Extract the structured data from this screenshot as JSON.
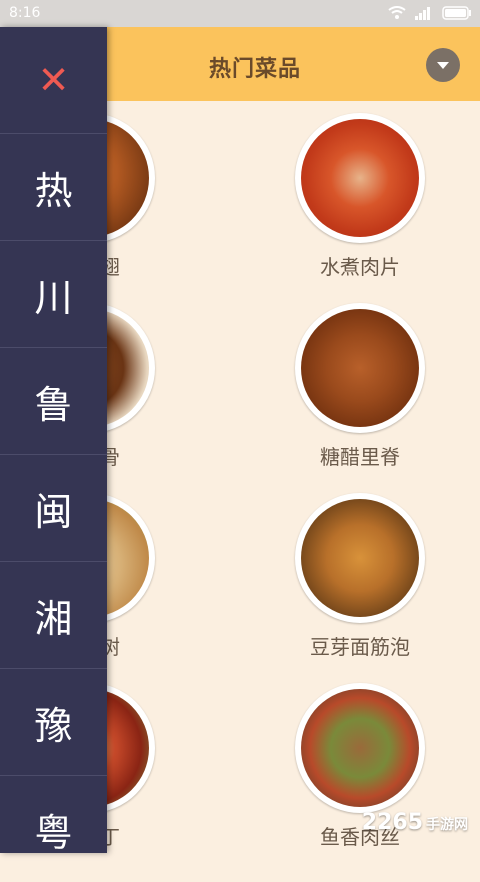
{
  "status_bar": {
    "time": "8:16",
    "icons": [
      "wifi-icon",
      "signal-icon",
      "battery-icon"
    ]
  },
  "header": {
    "title": "热门菜品",
    "dropdown_icon": "chevron-down-icon"
  },
  "dishes": [
    {
      "name": "东鸡翅"
    },
    {
      "name": "水煮肉片"
    },
    {
      "name": "醋排骨"
    },
    {
      "name": "糖醋里脊"
    },
    {
      "name": "蚁上树"
    },
    {
      "name": "豆芽面筋泡"
    },
    {
      "name": "爆鸡丁"
    },
    {
      "name": "鱼香肉丝"
    }
  ],
  "drawer": {
    "close_icon": "close-icon",
    "items": [
      {
        "label": "热"
      },
      {
        "label": "川"
      },
      {
        "label": "鲁"
      },
      {
        "label": "闽"
      },
      {
        "label": "湘"
      },
      {
        "label": "豫"
      },
      {
        "label": "粤"
      }
    ]
  },
  "watermark": {
    "text": "2265",
    "sub": "手游网"
  },
  "colors": {
    "header": "#fbc35c",
    "drawer": "#353553",
    "background": "#fbefe0",
    "close": "#ef5a52"
  }
}
